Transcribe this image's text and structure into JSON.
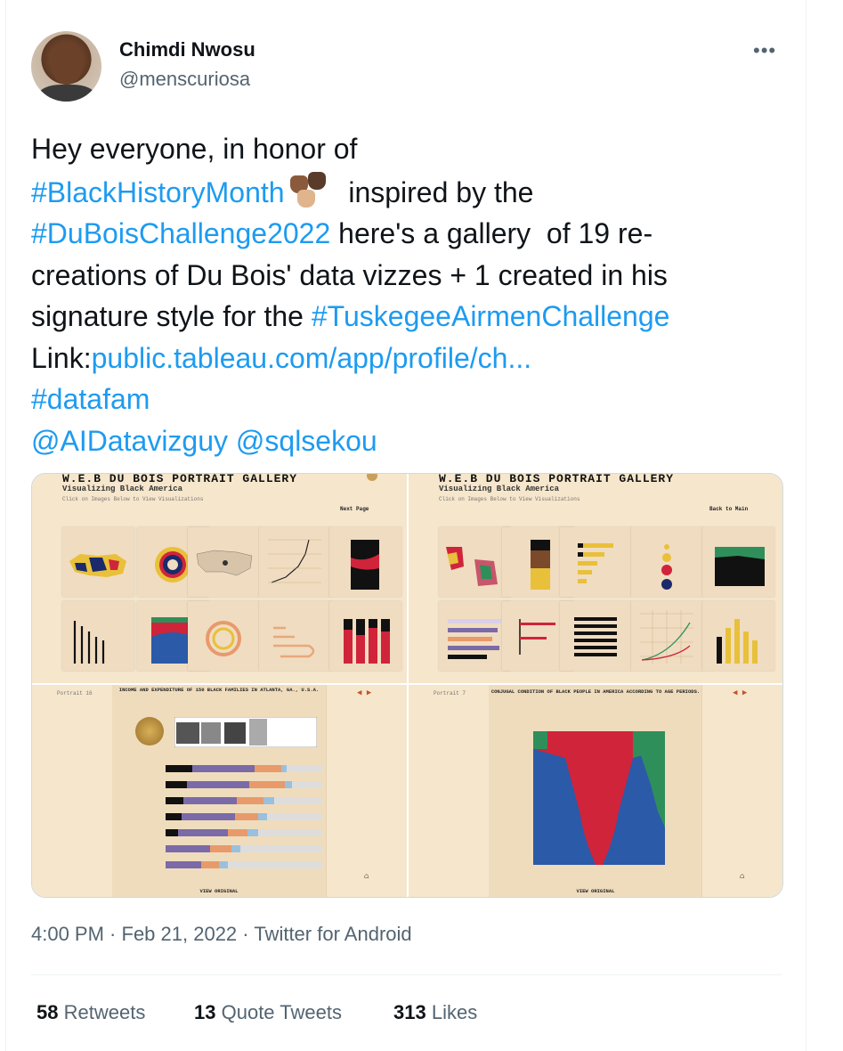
{
  "author": {
    "name": "Chimdi Nwosu",
    "handle": "@menscuriosa"
  },
  "menu_icon": "more-horizontal-icon",
  "tweet": {
    "line1": "Hey everyone, in honor of",
    "hashtag_bhm": "#BlackHistoryMonth",
    "inspired": "  inspired by the",
    "hashtag_dubois": "#DuBoisChallenge2022",
    "gallery_text": " here's a gallery  of 19 re-",
    "line4": "creations of Du Bois' data vizzes + 1 created in his",
    "line5_pre": "signature style for the ",
    "hashtag_tuskegee": "#TuskegeeAirmenChallenge",
    "link_label": "Link:",
    "link_url": "public.tableau.com/app/profile/ch...",
    "hashtag_datafam": "#datafam",
    "mention1": "@AIDatavizguy",
    "mention2": "@sqlsekou"
  },
  "media": {
    "panel1": {
      "title": "W.E.B DU BOIS PORTRAIT GALLERY",
      "subtitle": "Visualizing Black America",
      "hint": "Click on Images Below to View Visualizations",
      "button": "Next Page"
    },
    "panel2": {
      "title": "W.E.B DU BOIS PORTRAIT GALLERY",
      "subtitle": "Visualizing Black America",
      "hint": "Click on Images Below to View Visualizations",
      "button": "Back to Main"
    },
    "panel3": {
      "portrait": "Portrait 16",
      "title": "INCOME AND EXPENDITURE OF 150 BLACK FAMILIES IN ATLANTA, GA., U.S.A.",
      "footer": "VIEW ORIGINAL"
    },
    "panel4": {
      "portrait": "Portrait 7",
      "title": "CONJUGAL CONDITION OF BLACK PEOPLE IN AMERICA ACCORDING TO AGE PERIODS.",
      "footer": "VIEW ORIGINAL"
    }
  },
  "meta": {
    "time": "4:00 PM",
    "date": "Feb 21, 2022",
    "source": "Twitter for Android"
  },
  "stats": {
    "retweets_count": "58",
    "retweets_label": "Retweets",
    "quotes_count": "13",
    "quotes_label": "Quote Tweets",
    "likes_count": "313",
    "likes_label": "Likes"
  }
}
